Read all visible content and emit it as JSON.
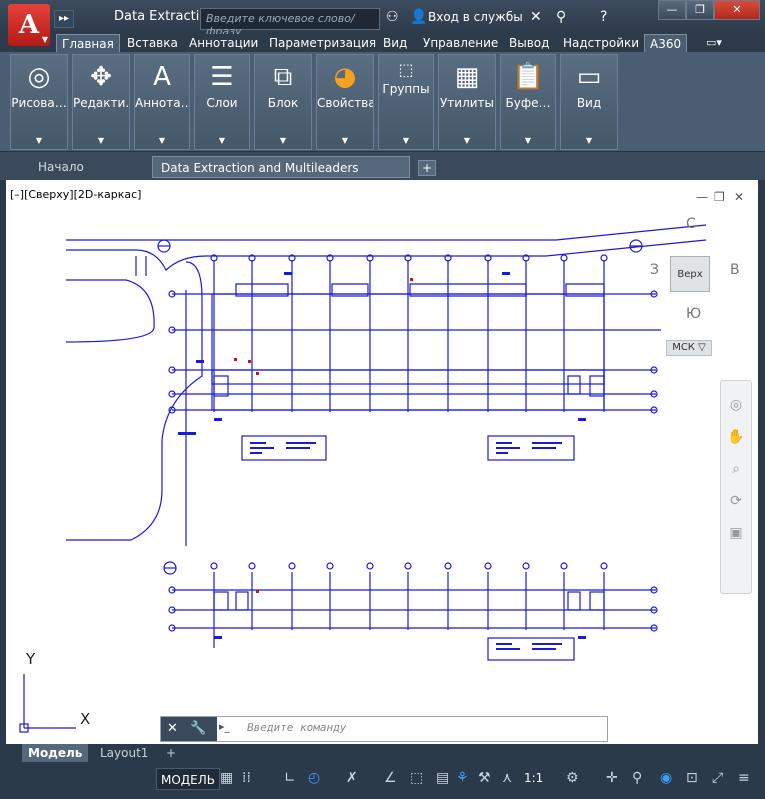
{
  "app": {
    "logo_letter": "A",
    "title": "Data Extracti…",
    "search_placeholder": "Введите ключевое слово/фразу",
    "login_label": "Вход в службы"
  },
  "ribbon_tabs": [
    "Главная",
    "Вставка",
    "Аннотации",
    "Параметризация",
    "Вид",
    "Управление",
    "Вывод",
    "Надстройки",
    "A360"
  ],
  "ribbon_panels": [
    {
      "label": "Рисова…",
      "icon": "line-draw-icon"
    },
    {
      "label": "Редакти…",
      "icon": "modify-icon"
    },
    {
      "label": "Аннота…",
      "icon": "annotation-icon"
    },
    {
      "label": "Слои",
      "icon": "layers-icon"
    },
    {
      "label": "Блок",
      "icon": "block-icon"
    },
    {
      "label": "Свойства",
      "icon": "properties-icon"
    },
    {
      "label": "Группы",
      "icon": "groups-icon"
    },
    {
      "label": "Утилиты",
      "icon": "calculator-icon"
    },
    {
      "label": "Буфе…",
      "icon": "clipboard-icon"
    },
    {
      "label": "Вид",
      "icon": "view-icon"
    }
  ],
  "doc_tabs": {
    "start": "Начало",
    "active": "Data Extraction and Multileaders Sample*"
  },
  "viewport": {
    "label": "[–][Сверху][2D-каркас]",
    "viewcube_face": "Верх",
    "compass": {
      "n": "С",
      "w": "З",
      "e": "В",
      "s": "Ю"
    },
    "ucs_label": "МСК",
    "axis_x": "X",
    "axis_y": "Y"
  },
  "command": {
    "placeholder": "Введите команду"
  },
  "layout_tabs": [
    "Модель",
    "Layout1"
  ],
  "status": {
    "model": "МОДЕЛЬ",
    "scale": "1:1"
  },
  "colors": {
    "drawing_lines": "#1a1adb",
    "ui_dark": "#2b3a4a",
    "ribbon": "#4a5d72"
  }
}
